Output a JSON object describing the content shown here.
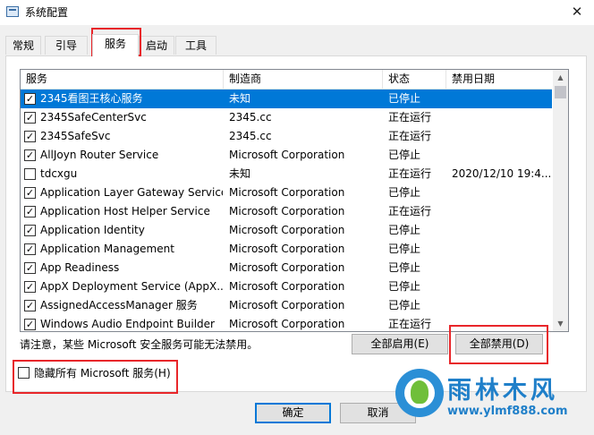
{
  "window": {
    "title": "系统配置",
    "close_glyph": "✕"
  },
  "tabs": [
    {
      "label": "常规"
    },
    {
      "label": "引导"
    },
    {
      "label": "服务"
    },
    {
      "label": "启动"
    },
    {
      "label": "工具"
    }
  ],
  "active_tab": "服务",
  "table": {
    "columns": [
      "服务",
      "制造商",
      "状态",
      "禁用日期"
    ],
    "rows": [
      {
        "checked": true,
        "name": "2345看图王核心服务",
        "maker": "未知",
        "status": "已停止",
        "date": "",
        "selected": true
      },
      {
        "checked": true,
        "name": "2345SafeCenterSvc",
        "maker": "2345.cc",
        "status": "正在运行",
        "date": ""
      },
      {
        "checked": true,
        "name": "2345SafeSvc",
        "maker": "2345.cc",
        "status": "正在运行",
        "date": ""
      },
      {
        "checked": true,
        "name": "AllJoyn Router Service",
        "maker": "Microsoft Corporation",
        "status": "已停止",
        "date": ""
      },
      {
        "checked": false,
        "name": "tdcxgu",
        "maker": "未知",
        "status": "正在运行",
        "date": "2020/12/10 19:4..."
      },
      {
        "checked": true,
        "name": "Application Layer Gateway Service",
        "maker": "Microsoft Corporation",
        "status": "已停止",
        "date": ""
      },
      {
        "checked": true,
        "name": "Application Host Helper Service",
        "maker": "Microsoft Corporation",
        "status": "正在运行",
        "date": ""
      },
      {
        "checked": true,
        "name": "Application Identity",
        "maker": "Microsoft Corporation",
        "status": "已停止",
        "date": ""
      },
      {
        "checked": true,
        "name": "Application Management",
        "maker": "Microsoft Corporation",
        "status": "已停止",
        "date": ""
      },
      {
        "checked": true,
        "name": "App Readiness",
        "maker": "Microsoft Corporation",
        "status": "已停止",
        "date": ""
      },
      {
        "checked": true,
        "name": "AppX Deployment Service (AppX...",
        "maker": "Microsoft Corporation",
        "status": "已停止",
        "date": ""
      },
      {
        "checked": true,
        "name": "AssignedAccessManager 服务",
        "maker": "Microsoft Corporation",
        "status": "已停止",
        "date": ""
      },
      {
        "checked": true,
        "name": "Windows Audio Endpoint Builder",
        "maker": "Microsoft Corporation",
        "status": "正在运行",
        "date": ""
      }
    ]
  },
  "note": "请注意，某些 Microsoft 安全服务可能无法禁用。",
  "buttons": {
    "enable_all": "全部启用(E)",
    "disable_all": "全部禁用(D)",
    "ok": "确定",
    "cancel": "取消"
  },
  "hide_ms": {
    "label": "隐藏所有 Microsoft 服务(H)",
    "checked": false
  },
  "watermark": {
    "name": "雨林木风",
    "url": "www.ylmf888.com"
  },
  "colors": {
    "selection": "#0078d7",
    "highlight_box": "#e8262a",
    "watermark": "#1f7fc9"
  }
}
